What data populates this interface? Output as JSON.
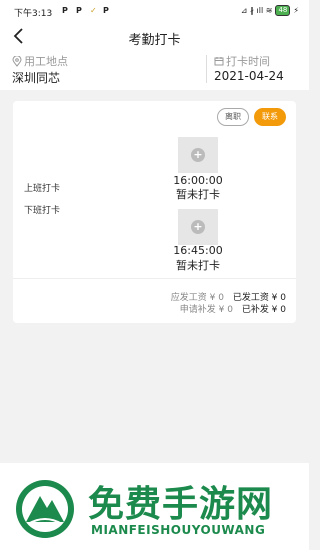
{
  "status_bar": {
    "time": "下午3:13",
    "icons": [
      "P",
      "P",
      "✓",
      "P"
    ],
    "right": "⊿ ∦ ıll ≋",
    "battery": "48"
  },
  "nav": {
    "title": "考勤打卡"
  },
  "info": {
    "location_label": "用工地点",
    "location_value": "深圳同芯",
    "date_label": "打卡时间",
    "date_value": "2021-04-24"
  },
  "card": {
    "leave_label": "离职",
    "contact_label": "联系",
    "checkin_label": "上班打卡",
    "checkout_label": "下班打卡",
    "checkin_time": "16:00:00",
    "checkin_status": "暂未打卡",
    "checkout_time": "16:45:00",
    "checkout_status": "暂未打卡",
    "wage_due_label": "应发工资 ¥ 0",
    "wage_paid_label": "已发工资 ¥ 0",
    "supplement_apply_label": "申请补发 ¥ 0",
    "supplement_paid_label": "已补发 ¥ 0"
  },
  "footer": {
    "brand": "免费手游网",
    "brand_sub": "MIANFEISHOUYOUWANG"
  },
  "colors": {
    "accent": "#f39a0b",
    "brand": "#1b8a4c"
  }
}
